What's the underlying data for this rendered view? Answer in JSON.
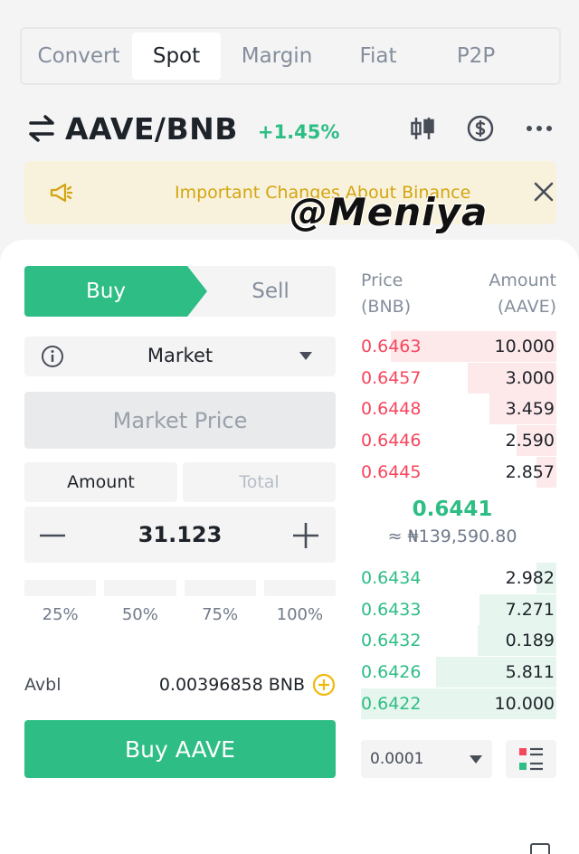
{
  "tabs": [
    {
      "label": "Convert",
      "active": false
    },
    {
      "label": "Spot",
      "active": true
    },
    {
      "label": "Margin",
      "active": false
    },
    {
      "label": "Fiat",
      "active": false
    },
    {
      "label": "P2P",
      "active": false
    }
  ],
  "pair": {
    "symbol": "AAVE/BNB",
    "change": "+1.45%",
    "icons": [
      "swap-icon",
      "candlestick-chart-icon",
      "dollar-circle-icon",
      "more-icon"
    ]
  },
  "banner": {
    "text": "Important Changes About Binance",
    "icons": [
      "megaphone-icon",
      "close-icon"
    ]
  },
  "watermark": "@Meniya",
  "trade": {
    "buy_label": "Buy",
    "sell_label": "Sell",
    "order_type": "Market",
    "price_placeholder": "Market Price",
    "amount_tab": "Amount",
    "total_tab": "Total",
    "amount_value": "31.123",
    "percents": [
      "25%",
      "50%",
      "75%",
      "100%"
    ],
    "avbl_label": "Avbl",
    "avbl_value": "0.00396858 BNB",
    "submit_label": "Buy AAVE"
  },
  "orderbook": {
    "price_header": "Price",
    "price_unit": "(BNB)",
    "amount_header": "Amount",
    "amount_unit": "(AAVE)",
    "asks": [
      {
        "price": "0.6463",
        "amount": "10.000",
        "depth": 0.84
      },
      {
        "price": "0.6457",
        "amount": "3.000",
        "depth": 0.45
      },
      {
        "price": "0.6448",
        "amount": "3.459",
        "depth": 0.34
      },
      {
        "price": "0.6446",
        "amount": "2.590",
        "depth": 0.2
      },
      {
        "price": "0.6445",
        "amount": "2.857",
        "depth": 0.1
      }
    ],
    "last_price": "0.6441",
    "last_fiat": "≈ ₦139,590.80",
    "bids": [
      {
        "price": "0.6434",
        "amount": "2.982",
        "depth": 0.1
      },
      {
        "price": "0.6433",
        "amount": "7.271",
        "depth": 0.39
      },
      {
        "price": "0.6432",
        "amount": "0.189",
        "depth": 0.4
      },
      {
        "price": "0.6426",
        "amount": "5.811",
        "depth": 0.61
      },
      {
        "price": "0.6422",
        "amount": "10.000",
        "depth": 0.99
      }
    ],
    "precision": "0.0001"
  },
  "colors": {
    "buy_green": "#2ebd85",
    "sell_red": "#f6465d",
    "banner_bg": "#f8f2dc",
    "banner_text": "#d4a510"
  }
}
